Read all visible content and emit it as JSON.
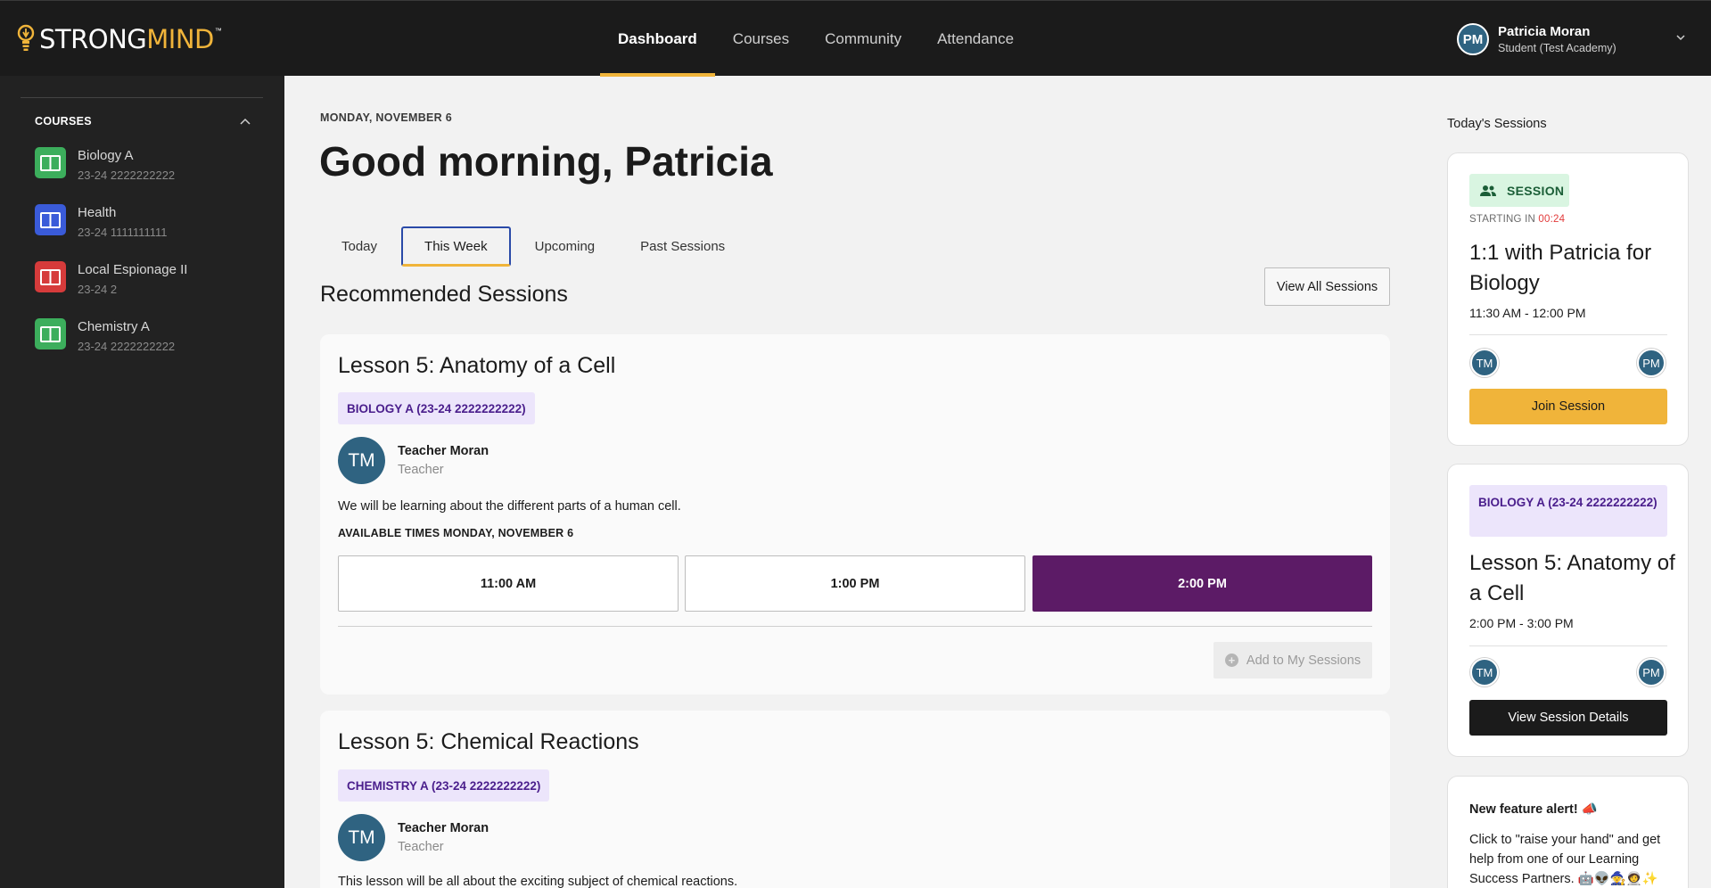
{
  "header": {
    "logo": {
      "part1": "STRONG",
      "part2": "MIND",
      "tm": "™"
    },
    "nav": [
      {
        "label": "Dashboard",
        "active": true
      },
      {
        "label": "Courses"
      },
      {
        "label": "Community"
      },
      {
        "label": "Attendance"
      }
    ],
    "user": {
      "initials": "PM",
      "name": "Patricia Moran",
      "role": "Student (Test Academy)"
    }
  },
  "sidebar": {
    "heading": "COURSES",
    "courses": [
      {
        "name": "Biology A",
        "code": "23-24 2222222222",
        "color": "#3cae5c"
      },
      {
        "name": "Health",
        "code": "23-24 1111111111",
        "color": "#3a5bd9"
      },
      {
        "name": "Local Espionage II",
        "code": "23-24 2",
        "color": "#d63b3b"
      },
      {
        "name": "Chemistry A",
        "code": "23-24 2222222222",
        "color": "#3cae5c"
      }
    ]
  },
  "main": {
    "date": "MONDAY, NOVEMBER 6",
    "greeting": "Good morning, Patricia",
    "tabs": [
      {
        "label": "Today"
      },
      {
        "label": "This Week",
        "active": true
      },
      {
        "label": "Upcoming"
      },
      {
        "label": "Past Sessions"
      }
    ],
    "section_title": "Recommended Sessions",
    "view_all_label": "View All Sessions",
    "sessions": [
      {
        "title": "Lesson 5: Anatomy of a Cell",
        "course": "BIOLOGY A (23-24 2222222222)",
        "teacher": {
          "initials": "TM",
          "name": "Teacher Moran",
          "role": "Teacher"
        },
        "description": "We will be learning about the different parts of a human cell.",
        "times_label": "AVAILABLE TIMES MONDAY, NOVEMBER 6",
        "times": [
          "11:00 AM",
          "1:00 PM",
          "2:00 PM"
        ],
        "selected_time": "2:00 PM",
        "add_label": "Add to My Sessions"
      },
      {
        "title": "Lesson 5: Chemical Reactions",
        "course": "CHEMISTRY A (23-24 2222222222)",
        "teacher": {
          "initials": "TM",
          "name": "Teacher Moran",
          "role": "Teacher"
        },
        "description": "This lesson will be all about the exciting subject of chemical reactions."
      }
    ]
  },
  "right_panel": {
    "title": "Today's Sessions",
    "session_card": {
      "badge": "SESSION",
      "starting_label": "STARTING IN",
      "countdown": "00:24",
      "title": "1:1 with Patricia for Biology",
      "time": "11:30 AM - 12:00 PM",
      "participants": [
        "TM",
        "PM"
      ],
      "button_label": "Join Session"
    },
    "lesson_card": {
      "badge": "BIOLOGY A (23-24 2222222222)",
      "title": "Lesson 5: Anatomy of a Cell",
      "time": "2:00 PM - 3:00 PM",
      "participants": [
        "TM",
        "PM"
      ],
      "button_label": "View Session Details"
    },
    "alert_card": {
      "title": "New feature alert! 📣",
      "text": "Click to \"raise your hand\" and get help from one of our Learning Success Partners. 🤖👽🧙🧑‍🚀✨"
    }
  },
  "colors": {
    "accent_gold": "#f0b43a",
    "selected_purple": "#5c1b66",
    "avatar_blue": "#2f6381",
    "badge_lavender": "#ece5fb"
  }
}
